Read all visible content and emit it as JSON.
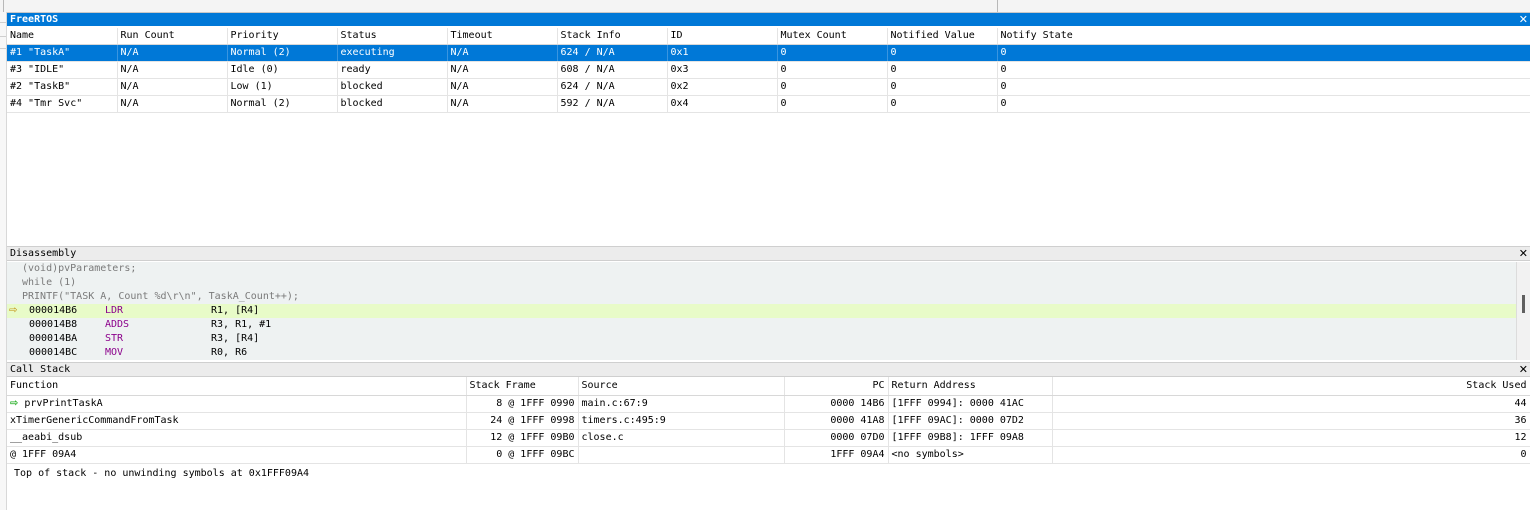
{
  "top_strip": {},
  "freertos": {
    "title": "FreeRTOS",
    "close": "✕",
    "columns": [
      "Name",
      "Run Count",
      "Priority",
      "Status",
      "Timeout",
      "Stack Info",
      "ID",
      "Mutex Count",
      "Notified Value",
      "Notify State"
    ],
    "rows": [
      [
        "#1 \"TaskA\"",
        "N/A",
        "Normal (2)",
        "executing",
        "N/A",
        "624 / N/A",
        "0x1",
        "0",
        "0",
        "0"
      ],
      [
        "#3 \"IDLE\"",
        "N/A",
        "Idle (0)",
        "ready",
        "N/A",
        "608 / N/A",
        "0x3",
        "0",
        "0",
        "0"
      ],
      [
        "#2 \"TaskB\"",
        "N/A",
        "Low (1)",
        "blocked",
        "N/A",
        "624 / N/A",
        "0x2",
        "0",
        "0",
        "0"
      ],
      [
        "#4 \"Tmr Svc\"",
        "N/A",
        "Normal (2)",
        "blocked",
        "N/A",
        "592 / N/A",
        "0x4",
        "0",
        "0",
        "0"
      ]
    ]
  },
  "disassembly": {
    "title": "Disassembly",
    "close": "✕",
    "source_lines": [
      "(void)pvParameters;",
      "while (1)",
      "PRINTF(\"TASK A, Count %d\\r\\n\", TaskA_Count++);"
    ],
    "current_marker": "⇨",
    "instructions": [
      {
        "addr": "000014B6",
        "op": "LDR",
        "args": "R1, [R4]"
      },
      {
        "addr": "000014B8",
        "op": "ADDS",
        "args": "R3, R1, #1"
      },
      {
        "addr": "000014BA",
        "op": "STR",
        "args": "R3, [R4]"
      },
      {
        "addr": "000014BC",
        "op": "MOV",
        "args": "R0, R6"
      }
    ]
  },
  "callstack": {
    "title": "Call Stack",
    "close": "✕",
    "columns": [
      "Function",
      "Stack Frame",
      "Source",
      "PC",
      "Return Address",
      "Stack Used"
    ],
    "current_marker": "⇨",
    "rows": [
      [
        "prvPrintTaskA",
        "8 @ 1FFF 0990",
        "main.c:67:9",
        "0000 14B6",
        "[1FFF 0994]: 0000 41AC",
        "44"
      ],
      [
        "xTimerGenericCommandFromTask",
        "24 @ 1FFF 0998",
        "timers.c:495:9",
        "0000 41A8",
        "[1FFF 09AC]: 0000 07D2",
        "36"
      ],
      [
        "__aeabi_dsub",
        "12 @ 1FFF 09B0",
        "close.c",
        "0000 07D0",
        "[1FFF 09B8]: 1FFF 09A8",
        "12"
      ],
      [
        "@ 1FFF 09A4",
        "0 @ 1FFF 09BC",
        "",
        "1FFF 09A4",
        "<no symbols>",
        "0"
      ]
    ],
    "footer": "Top of stack - no unwinding symbols at 0x1FFF09A4"
  }
}
